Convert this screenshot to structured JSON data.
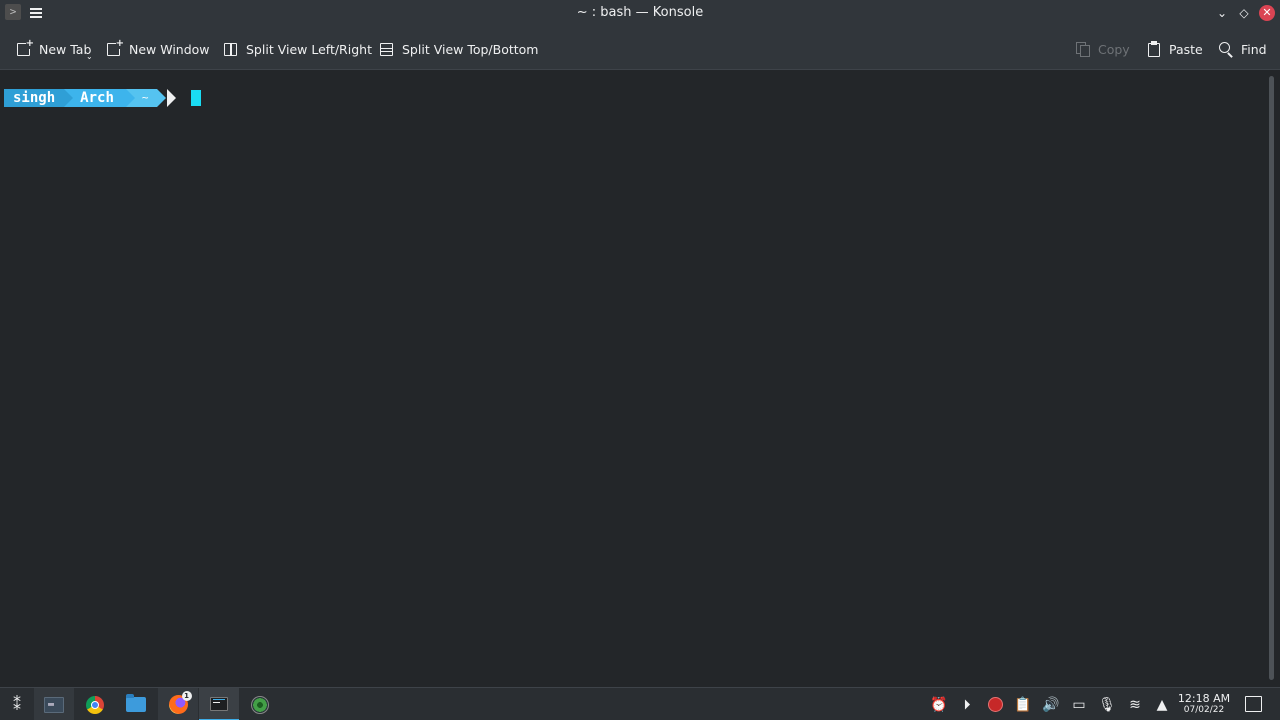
{
  "window": {
    "title": "~ : bash — Konsole",
    "controls": {
      "minimize": "⌄",
      "maximize": "◇",
      "close": "✕"
    }
  },
  "toolbar": {
    "new_tab": "New Tab",
    "new_window": "New Window",
    "split_lr": "Split View Left/Right",
    "split_tb": "Split View Top/Bottom",
    "copy": "Copy",
    "paste": "Paste",
    "find": "Find"
  },
  "terminal": {
    "prompt": {
      "user": "singh",
      "host": "Arch",
      "dir": "~"
    },
    "cursor_color": "#1adcf3"
  },
  "taskbar": {
    "apps": [
      {
        "name": "launcher",
        "icon": "launcher-icon"
      },
      {
        "name": "terminal",
        "icon": "terminal-icon"
      },
      {
        "name": "chrome",
        "icon": "chrome-icon"
      },
      {
        "name": "files",
        "icon": "folder-icon"
      },
      {
        "name": "firefox",
        "icon": "firefox-icon",
        "badge": "1"
      },
      {
        "name": "konsole",
        "icon": "konsole-icon",
        "active": true
      },
      {
        "name": "app",
        "icon": "green-circle-icon"
      }
    ],
    "tray": {
      "icons": [
        "alarm-icon",
        "media-play-icon",
        "record-icon",
        "clipboard-icon",
        "volume-icon",
        "battery-icon",
        "microphone-muted-icon",
        "wifi-icon",
        "expand-tray-icon"
      ]
    },
    "clock": {
      "time": "12:18 AM",
      "date": "07/02/22"
    }
  },
  "colors": {
    "accent": "#3daee9",
    "prompt_user_bg": "#2f9fd6",
    "prompt_host_bg": "#3db4ec",
    "prompt_dir_bg": "#55c3f0",
    "close_button": "#da4453",
    "terminal_bg": "#232629"
  }
}
